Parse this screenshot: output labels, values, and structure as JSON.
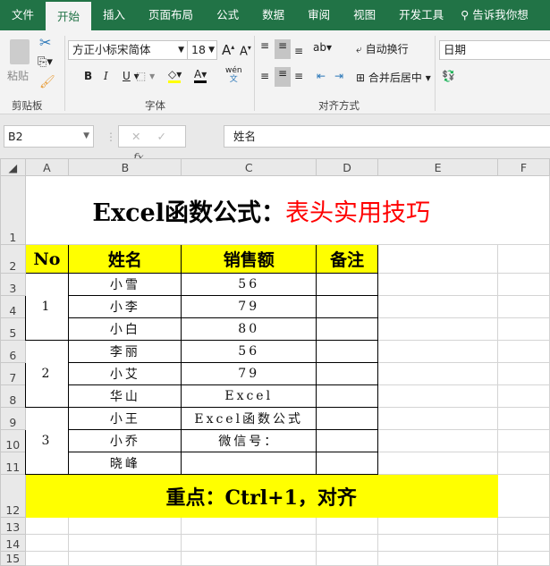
{
  "tabs": [
    "文件",
    "开始",
    "插入",
    "页面布局",
    "公式",
    "数据",
    "审阅",
    "视图",
    "开发工具"
  ],
  "tell_me": "告诉我你想",
  "ribbon": {
    "paste": "粘贴",
    "clipboard": "剪贴板",
    "font_name": "方正小标宋简体",
    "font_size": "18",
    "font_group": "字体",
    "bold": "B",
    "italic": "I",
    "underline": "U",
    "font_color": "A",
    "phonetic_top": "wén",
    "phonetic_bot": "文",
    "wrap_text": "自动换行",
    "merge_center": "合并后居中",
    "align_group": "对齐方式",
    "number_format": "日期",
    "highlight_color": "#ffff00",
    "font_color_bar": "#000000"
  },
  "formula_bar": {
    "name_box": "B2",
    "fx": "fx",
    "content": "姓名"
  },
  "columns": [
    "A",
    "B",
    "C",
    "D",
    "E",
    "F"
  ],
  "rows": [
    "1",
    "2",
    "3",
    "4",
    "5",
    "6",
    "7",
    "8",
    "9",
    "10",
    "11",
    "12",
    "13",
    "14",
    "15"
  ],
  "sheet": {
    "title_black": "Excel函数公式：",
    "title_red": "表头实用技巧",
    "headers": [
      "No",
      "姓名",
      "销售额",
      "备注"
    ],
    "groups": [
      "1",
      "2",
      "3"
    ],
    "names": [
      "小雪",
      "小李",
      "小白",
      "李丽",
      "小艾",
      "华山",
      "小王",
      "小乔",
      "晓峰"
    ],
    "sales": [
      "56",
      "79",
      "80",
      "56",
      "79",
      "Excel",
      "Excel函数公式",
      "微信号：",
      ""
    ],
    "footer": "重点：Ctrl+1，对齐"
  },
  "colors": {
    "accent": "#217346",
    "title_red": "#ff0000",
    "highlight": "#ffff00"
  }
}
